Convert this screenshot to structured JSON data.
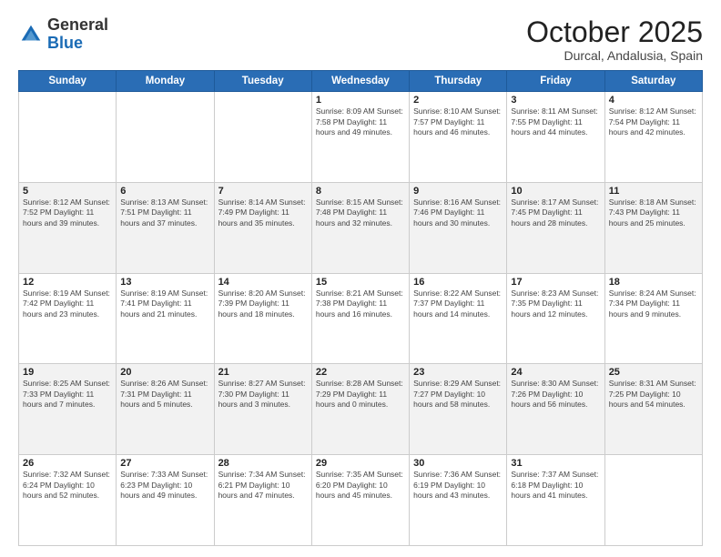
{
  "header": {
    "logo_general": "General",
    "logo_blue": "Blue",
    "month_title": "October 2025",
    "location": "Durcal, Andalusia, Spain"
  },
  "days_of_week": [
    "Sunday",
    "Monday",
    "Tuesday",
    "Wednesday",
    "Thursday",
    "Friday",
    "Saturday"
  ],
  "weeks": [
    [
      {
        "day": "",
        "info": ""
      },
      {
        "day": "",
        "info": ""
      },
      {
        "day": "",
        "info": ""
      },
      {
        "day": "1",
        "info": "Sunrise: 8:09 AM\nSunset: 7:58 PM\nDaylight: 11 hours and 49 minutes."
      },
      {
        "day": "2",
        "info": "Sunrise: 8:10 AM\nSunset: 7:57 PM\nDaylight: 11 hours and 46 minutes."
      },
      {
        "day": "3",
        "info": "Sunrise: 8:11 AM\nSunset: 7:55 PM\nDaylight: 11 hours and 44 minutes."
      },
      {
        "day": "4",
        "info": "Sunrise: 8:12 AM\nSunset: 7:54 PM\nDaylight: 11 hours and 42 minutes."
      }
    ],
    [
      {
        "day": "5",
        "info": "Sunrise: 8:12 AM\nSunset: 7:52 PM\nDaylight: 11 hours and 39 minutes."
      },
      {
        "day": "6",
        "info": "Sunrise: 8:13 AM\nSunset: 7:51 PM\nDaylight: 11 hours and 37 minutes."
      },
      {
        "day": "7",
        "info": "Sunrise: 8:14 AM\nSunset: 7:49 PM\nDaylight: 11 hours and 35 minutes."
      },
      {
        "day": "8",
        "info": "Sunrise: 8:15 AM\nSunset: 7:48 PM\nDaylight: 11 hours and 32 minutes."
      },
      {
        "day": "9",
        "info": "Sunrise: 8:16 AM\nSunset: 7:46 PM\nDaylight: 11 hours and 30 minutes."
      },
      {
        "day": "10",
        "info": "Sunrise: 8:17 AM\nSunset: 7:45 PM\nDaylight: 11 hours and 28 minutes."
      },
      {
        "day": "11",
        "info": "Sunrise: 8:18 AM\nSunset: 7:43 PM\nDaylight: 11 hours and 25 minutes."
      }
    ],
    [
      {
        "day": "12",
        "info": "Sunrise: 8:19 AM\nSunset: 7:42 PM\nDaylight: 11 hours and 23 minutes."
      },
      {
        "day": "13",
        "info": "Sunrise: 8:19 AM\nSunset: 7:41 PM\nDaylight: 11 hours and 21 minutes."
      },
      {
        "day": "14",
        "info": "Sunrise: 8:20 AM\nSunset: 7:39 PM\nDaylight: 11 hours and 18 minutes."
      },
      {
        "day": "15",
        "info": "Sunrise: 8:21 AM\nSunset: 7:38 PM\nDaylight: 11 hours and 16 minutes."
      },
      {
        "day": "16",
        "info": "Sunrise: 8:22 AM\nSunset: 7:37 PM\nDaylight: 11 hours and 14 minutes."
      },
      {
        "day": "17",
        "info": "Sunrise: 8:23 AM\nSunset: 7:35 PM\nDaylight: 11 hours and 12 minutes."
      },
      {
        "day": "18",
        "info": "Sunrise: 8:24 AM\nSunset: 7:34 PM\nDaylight: 11 hours and 9 minutes."
      }
    ],
    [
      {
        "day": "19",
        "info": "Sunrise: 8:25 AM\nSunset: 7:33 PM\nDaylight: 11 hours and 7 minutes."
      },
      {
        "day": "20",
        "info": "Sunrise: 8:26 AM\nSunset: 7:31 PM\nDaylight: 11 hours and 5 minutes."
      },
      {
        "day": "21",
        "info": "Sunrise: 8:27 AM\nSunset: 7:30 PM\nDaylight: 11 hours and 3 minutes."
      },
      {
        "day": "22",
        "info": "Sunrise: 8:28 AM\nSunset: 7:29 PM\nDaylight: 11 hours and 0 minutes."
      },
      {
        "day": "23",
        "info": "Sunrise: 8:29 AM\nSunset: 7:27 PM\nDaylight: 10 hours and 58 minutes."
      },
      {
        "day": "24",
        "info": "Sunrise: 8:30 AM\nSunset: 7:26 PM\nDaylight: 10 hours and 56 minutes."
      },
      {
        "day": "25",
        "info": "Sunrise: 8:31 AM\nSunset: 7:25 PM\nDaylight: 10 hours and 54 minutes."
      }
    ],
    [
      {
        "day": "26",
        "info": "Sunrise: 7:32 AM\nSunset: 6:24 PM\nDaylight: 10 hours and 52 minutes."
      },
      {
        "day": "27",
        "info": "Sunrise: 7:33 AM\nSunset: 6:23 PM\nDaylight: 10 hours and 49 minutes."
      },
      {
        "day": "28",
        "info": "Sunrise: 7:34 AM\nSunset: 6:21 PM\nDaylight: 10 hours and 47 minutes."
      },
      {
        "day": "29",
        "info": "Sunrise: 7:35 AM\nSunset: 6:20 PM\nDaylight: 10 hours and 45 minutes."
      },
      {
        "day": "30",
        "info": "Sunrise: 7:36 AM\nSunset: 6:19 PM\nDaylight: 10 hours and 43 minutes."
      },
      {
        "day": "31",
        "info": "Sunrise: 7:37 AM\nSunset: 6:18 PM\nDaylight: 10 hours and 41 minutes."
      },
      {
        "day": "",
        "info": ""
      }
    ]
  ]
}
